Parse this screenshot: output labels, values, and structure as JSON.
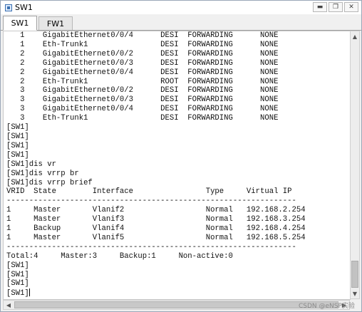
{
  "window": {
    "title": "SW1"
  },
  "tabs": [
    {
      "label": "SW1",
      "active": true
    },
    {
      "label": "FW1",
      "active": false
    }
  ],
  "console": {
    "lines": [
      "   1    GigabitEthernet0/0/4      DESI  FORWARDING      NONE",
      "   1    Eth-Trunk1                DESI  FORWARDING      NONE",
      "   2    GigabitEthernet0/0/2      DESI  FORWARDING      NONE",
      "   2    GigabitEthernet0/0/3      DESI  FORWARDING      NONE",
      "   2    GigabitEthernet0/0/4      DESI  FORWARDING      NONE",
      "   2    Eth-Trunk1                ROOT  FORWARDING      NONE",
      "   3    GigabitEthernet0/0/2      DESI  FORWARDING      NONE",
      "   3    GigabitEthernet0/0/3      DESI  FORWARDING      NONE",
      "   3    GigabitEthernet0/0/4      DESI  FORWARDING      NONE",
      "   3    Eth-Trunk1                DESI  FORWARDING      NONE",
      "[SW1]",
      "[SW1]",
      "[SW1]",
      "[SW1]",
      "[SW1]dis vr",
      "[SW1]dis vrrp br",
      "[SW1]dis vrrp brief",
      "VRID  State        Interface                Type     Virtual IP",
      "----------------------------------------------------------------",
      "1     Master       Vlanif2                  Normal   192.168.2.254",
      "1     Master       Vlanif3                  Normal   192.168.3.254",
      "1     Backup       Vlanif4                  Normal   192.168.4.254",
      "1     Master       Vlanif5                  Normal   192.168.5.254",
      "----------------------------------------------------------------",
      "Total:4     Master:3     Backup:1     Non-active:0",
      "[SW1]",
      "[SW1]",
      "[SW1]",
      "[SW1]"
    ]
  },
  "watermark": "CSDN @eNSP实验"
}
